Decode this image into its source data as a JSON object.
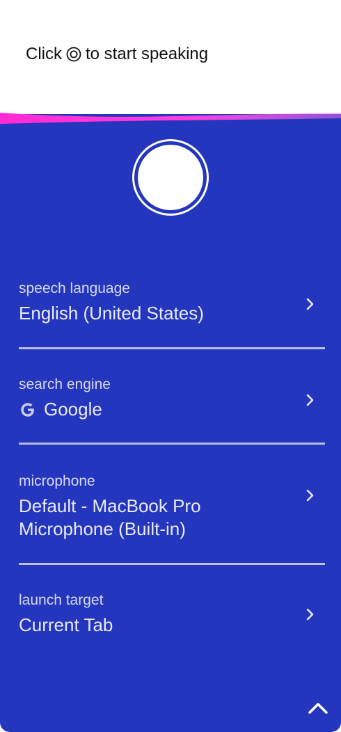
{
  "header": {
    "prompt_before": "Click",
    "prompt_icon": "mic-circle-icon",
    "prompt_after": "to start speaking"
  },
  "record_button": {
    "icon": "record-circle-icon"
  },
  "settings": [
    {
      "label": "speech language",
      "value": "English (United States)",
      "icon": "chevron-right-icon"
    },
    {
      "label": "search engine",
      "value": "Google",
      "value_icon": "google-g-icon",
      "icon": "chevron-right-icon"
    },
    {
      "label": "microphone",
      "value_line1": "Default - MacBook Pro",
      "value_line2": "Microphone (Built-in)",
      "icon": "chevron-right-icon"
    },
    {
      "label": "launch target",
      "value": "Current Tab",
      "icon": "chevron-right-icon"
    }
  ],
  "footer": {
    "collapse_icon": "chevron-up-icon"
  },
  "colors": {
    "panel": "#2336bd",
    "accent_magenta": "#ff2fd6",
    "text_light": "#e8eaff",
    "divider": "#b9bfe9"
  }
}
